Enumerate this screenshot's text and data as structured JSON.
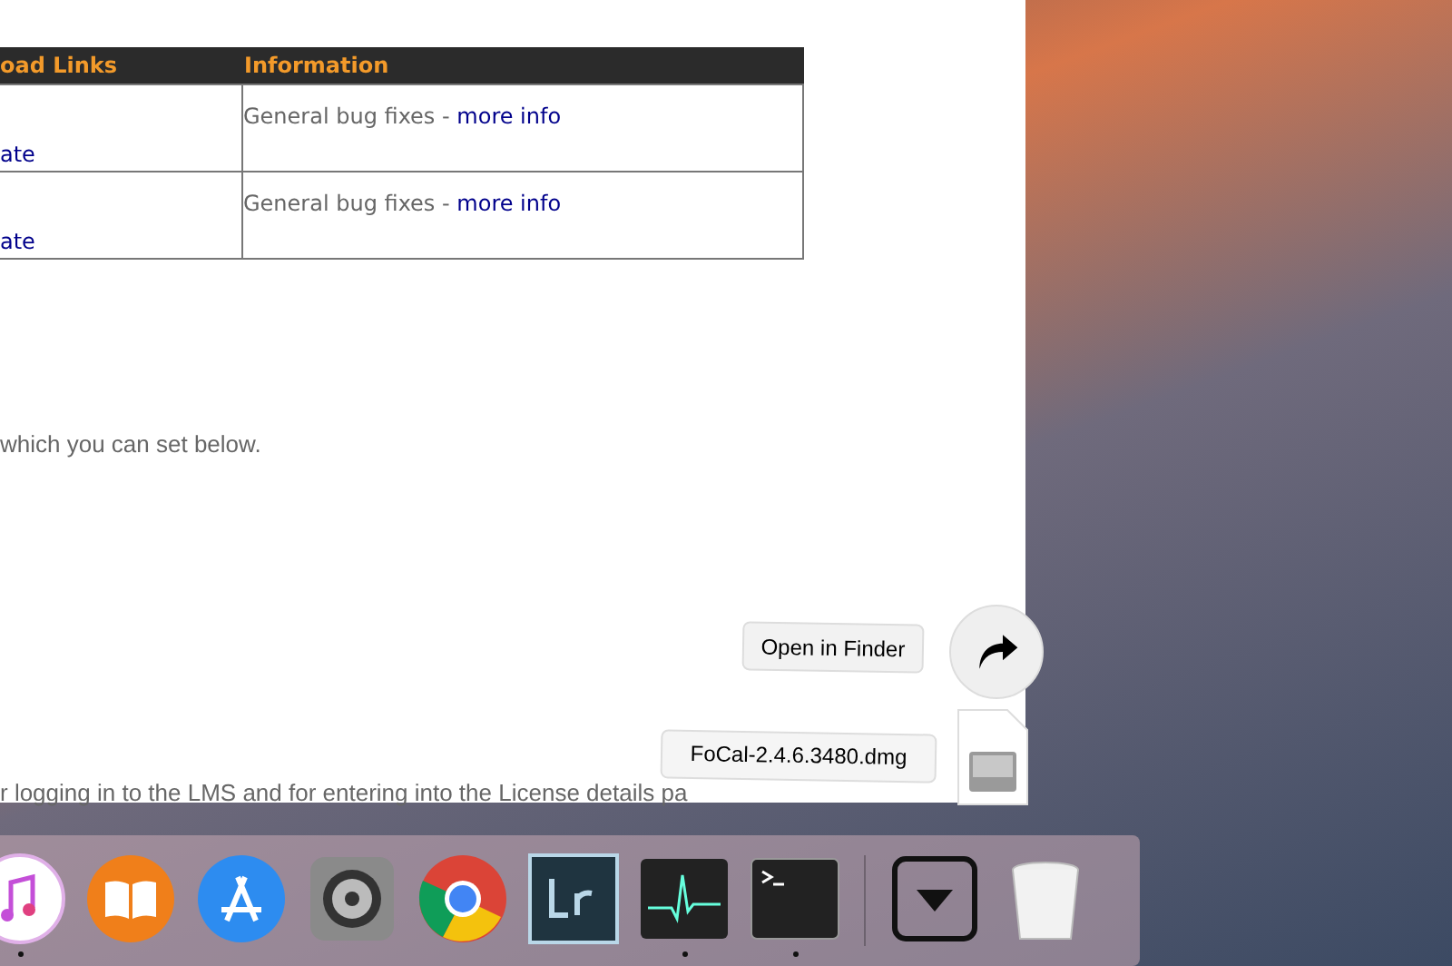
{
  "web_page": {
    "table": {
      "columns": [
        "oad Links",
        "Information"
      ],
      "rows": [
        {
          "link": "ate",
          "info": "General bug fixes - ",
          "info_link": "more info"
        },
        {
          "link": "ate",
          "info": "General bug fixes - ",
          "info_link": "more info"
        }
      ]
    },
    "paragraphs": [
      "which you can set below.",
      "r logging in to the LMS and for entering into the License details pa"
    ]
  },
  "download_popup": {
    "open_button": "Open in Finder",
    "file_name": "FoCal-2.4.6.3480.dmg"
  },
  "dock": {
    "apps": [
      {
        "kind": "music",
        "running": true
      },
      {
        "kind": "books",
        "running": false
      },
      {
        "kind": "appstore",
        "running": false
      },
      {
        "kind": "settings",
        "running": false
      },
      {
        "kind": "browser",
        "running": false
      },
      {
        "kind": "lr",
        "running": false
      },
      {
        "kind": "monitor",
        "running": true
      },
      {
        "kind": "terminal",
        "running": true
      }
    ],
    "stacks": [
      {
        "kind": "downloads"
      },
      {
        "kind": "trash"
      }
    ]
  }
}
